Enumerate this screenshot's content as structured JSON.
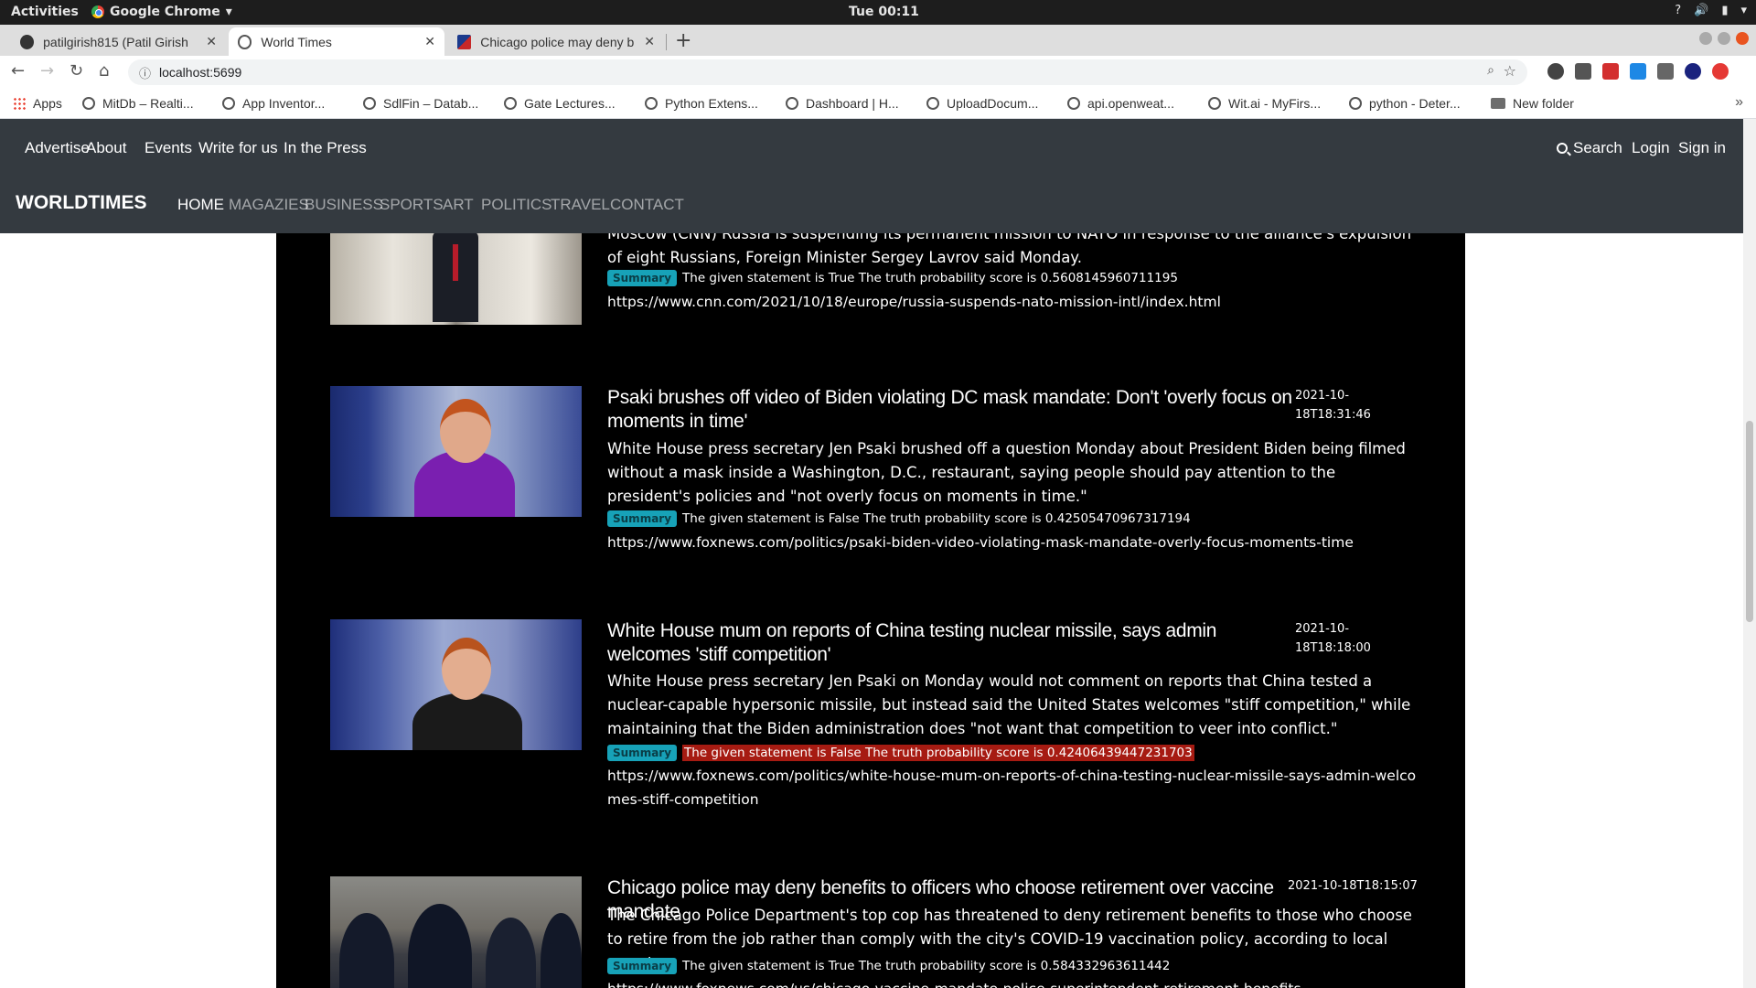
{
  "os": {
    "activities": "Activities",
    "app_name": "Google Chrome",
    "clock": "Tue 00:11"
  },
  "browser": {
    "tabs": [
      {
        "title": "patilgirish815 (Patil Girish",
        "active": false
      },
      {
        "title": "World Times",
        "active": true
      },
      {
        "title": "Chicago police may deny b",
        "active": false
      }
    ],
    "url": "localhost:5699",
    "bookmarks": [
      "Apps",
      "MitDb – Realti...",
      "App Inventor...",
      "SdlFin – Datab...",
      "Gate Lectures...",
      "Python Extens...",
      "Dashboard | H...",
      "UploadDocum...",
      "api.openweat...",
      "Wit.ai - MyFirs...",
      "python - Deter...",
      "New folder"
    ],
    "more": "»"
  },
  "site": {
    "top_links": [
      "Advertise",
      "About",
      "Events",
      "Write for us",
      "In the Press"
    ],
    "right_links": {
      "search": "Search",
      "login": "Login",
      "signin": "Sign in"
    },
    "brand": "WORLDTIMES",
    "main_nav": [
      "HOME",
      "MAGAZIES",
      "BUSINESS",
      "SPORTS",
      "ART",
      "POLITICS",
      "TRAVEL",
      "CONTACT"
    ]
  },
  "articles": [
    {
      "title": "",
      "date": "",
      "description": "Moscow (CNN) Russia is suspending its permanent mission to NATO in response to the alliance's expulsion of eight Russians, Foreign Minister Sergey Lavrov said Monday.",
      "summary_label": "Summary",
      "verdict": "The given statement is True The truth probability score is 0.5608145960711195",
      "url": "https://www.cnn.com/2021/10/18/europe/russia-suspends-nato-mission-intl/index.html",
      "highlighted": false
    },
    {
      "title": "Psaki brushes off video of Biden violating DC mask mandate: Don't 'overly focus on moments in time'",
      "date": "2021-10-18T18:31:46",
      "description": "White House press secretary Jen Psaki brushed off a question Monday about President Biden being filmed without a mask inside a Washington, D.C., restaurant, saying people should pay attention to the president's policies and \"not overly focus on moments in time.\"",
      "summary_label": "Summary",
      "verdict": "The given statement is False The truth probability score is 0.42505470967317194",
      "url": "https://www.foxnews.com/politics/psaki-biden-video-violating-mask-mandate-overly-focus-moments-time",
      "highlighted": false
    },
    {
      "title": "White House mum on reports of China testing nuclear missile, says admin welcomes 'stiff competition'",
      "date": "2021-10-18T18:18:00",
      "description": "White House press secretary Jen Psaki on Monday would not comment on reports that China tested a nuclear-capable hypersonic missile, but instead said the United States welcomes \"stiff competition,\" while maintaining that the Biden administration does \"not want that competition to veer into conflict.\"",
      "summary_label": "Summary",
      "verdict": "The given statement is False The truth probability score is 0.42406439447231703",
      "url": "https://www.foxnews.com/politics/white-house-mum-on-reports-of-china-testing-nuclear-missile-says-admin-welcomes-stiff-competition",
      "highlighted": true
    },
    {
      "title": "Chicago police may deny benefits to officers who choose retirement over vaccine mandate",
      "date": "2021-10-18T18:15:07",
      "description": "The Chicago Police Department's top cop has threatened to deny retirement benefits to those who choose to retire from the job rather than comply with the city's COVID-19 vaccination policy, according to local reports.",
      "summary_label": "Summary",
      "verdict": "The given statement is True The truth probability score is 0.584332963611442",
      "url": "https://www.foxnews.com/us/chicago-vaccine-mandate-police-superintendent-retirement-benefits",
      "highlighted": false
    }
  ],
  "colors": {
    "navbar": "#343a40",
    "content_bg": "#000000",
    "badge": "#17a2b8",
    "highlight": "#a61b12"
  }
}
